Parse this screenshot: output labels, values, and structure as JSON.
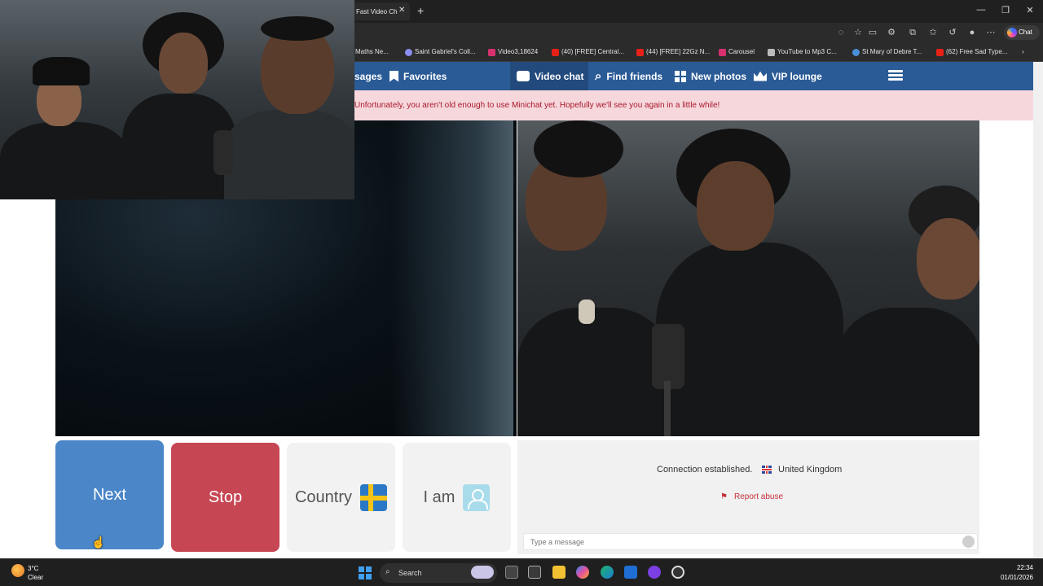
{
  "browser": {
    "active_tab_title": "Fast Video Ch",
    "tab_close_glyph": "✕",
    "new_tab_glyph": "+",
    "window_controls": [
      "—",
      "❐",
      "✕"
    ],
    "copilot_label": "Chat",
    "bookmarks": [
      {
        "label": "Maths Ne...",
        "color": "#3a7bd5"
      },
      {
        "label": "Saint Gabriel's Coll...",
        "color": "#8a8cf0"
      },
      {
        "label": "Video3,18624",
        "color": "#d6306f"
      },
      {
        "label": "(40) [FREE] Central...",
        "color": "#e62117"
      },
      {
        "label": "(44) [FREE] 22Gz N...",
        "color": "#e62117"
      },
      {
        "label": "Carousel",
        "color": "#d6306f"
      },
      {
        "label": "YouTube to Mp3 C...",
        "color": "#bbbbbb"
      },
      {
        "label": "St Mary of Debre T...",
        "color": "#4a90d9"
      },
      {
        "label": "(62) Free Sad Type...",
        "color": "#e62117"
      }
    ]
  },
  "site": {
    "nav": {
      "messages_partial": "sages",
      "favorites": "Favorites",
      "video_chat": "Video chat",
      "find_friends": "Find friends",
      "new_photos": "New photos",
      "vip_lounge": "VIP lounge"
    },
    "alert": "Unfortunately, you aren't old enough to use Minichat yet. Hopefully we'll see you again in a little while!",
    "controls": {
      "next": "Next",
      "stop": "Stop",
      "country": "Country",
      "i_am": "I am"
    },
    "chat": {
      "connection_status": "Connection established.",
      "partner_country": "United Kingdom",
      "report_abuse": "Report abuse",
      "message_placeholder": "Type a message"
    }
  },
  "taskbar": {
    "weather_temp": "3°C",
    "weather_desc": "Clear",
    "search_label": "Search",
    "time": "22:34",
    "date": "01/01/2026"
  },
  "colors": {
    "nav_bg": "#2a5b96",
    "next_button": "#4a86c8",
    "stop_button": "#c64653",
    "alert_bg": "#f6d7dc",
    "alert_text": "#a8192b"
  }
}
